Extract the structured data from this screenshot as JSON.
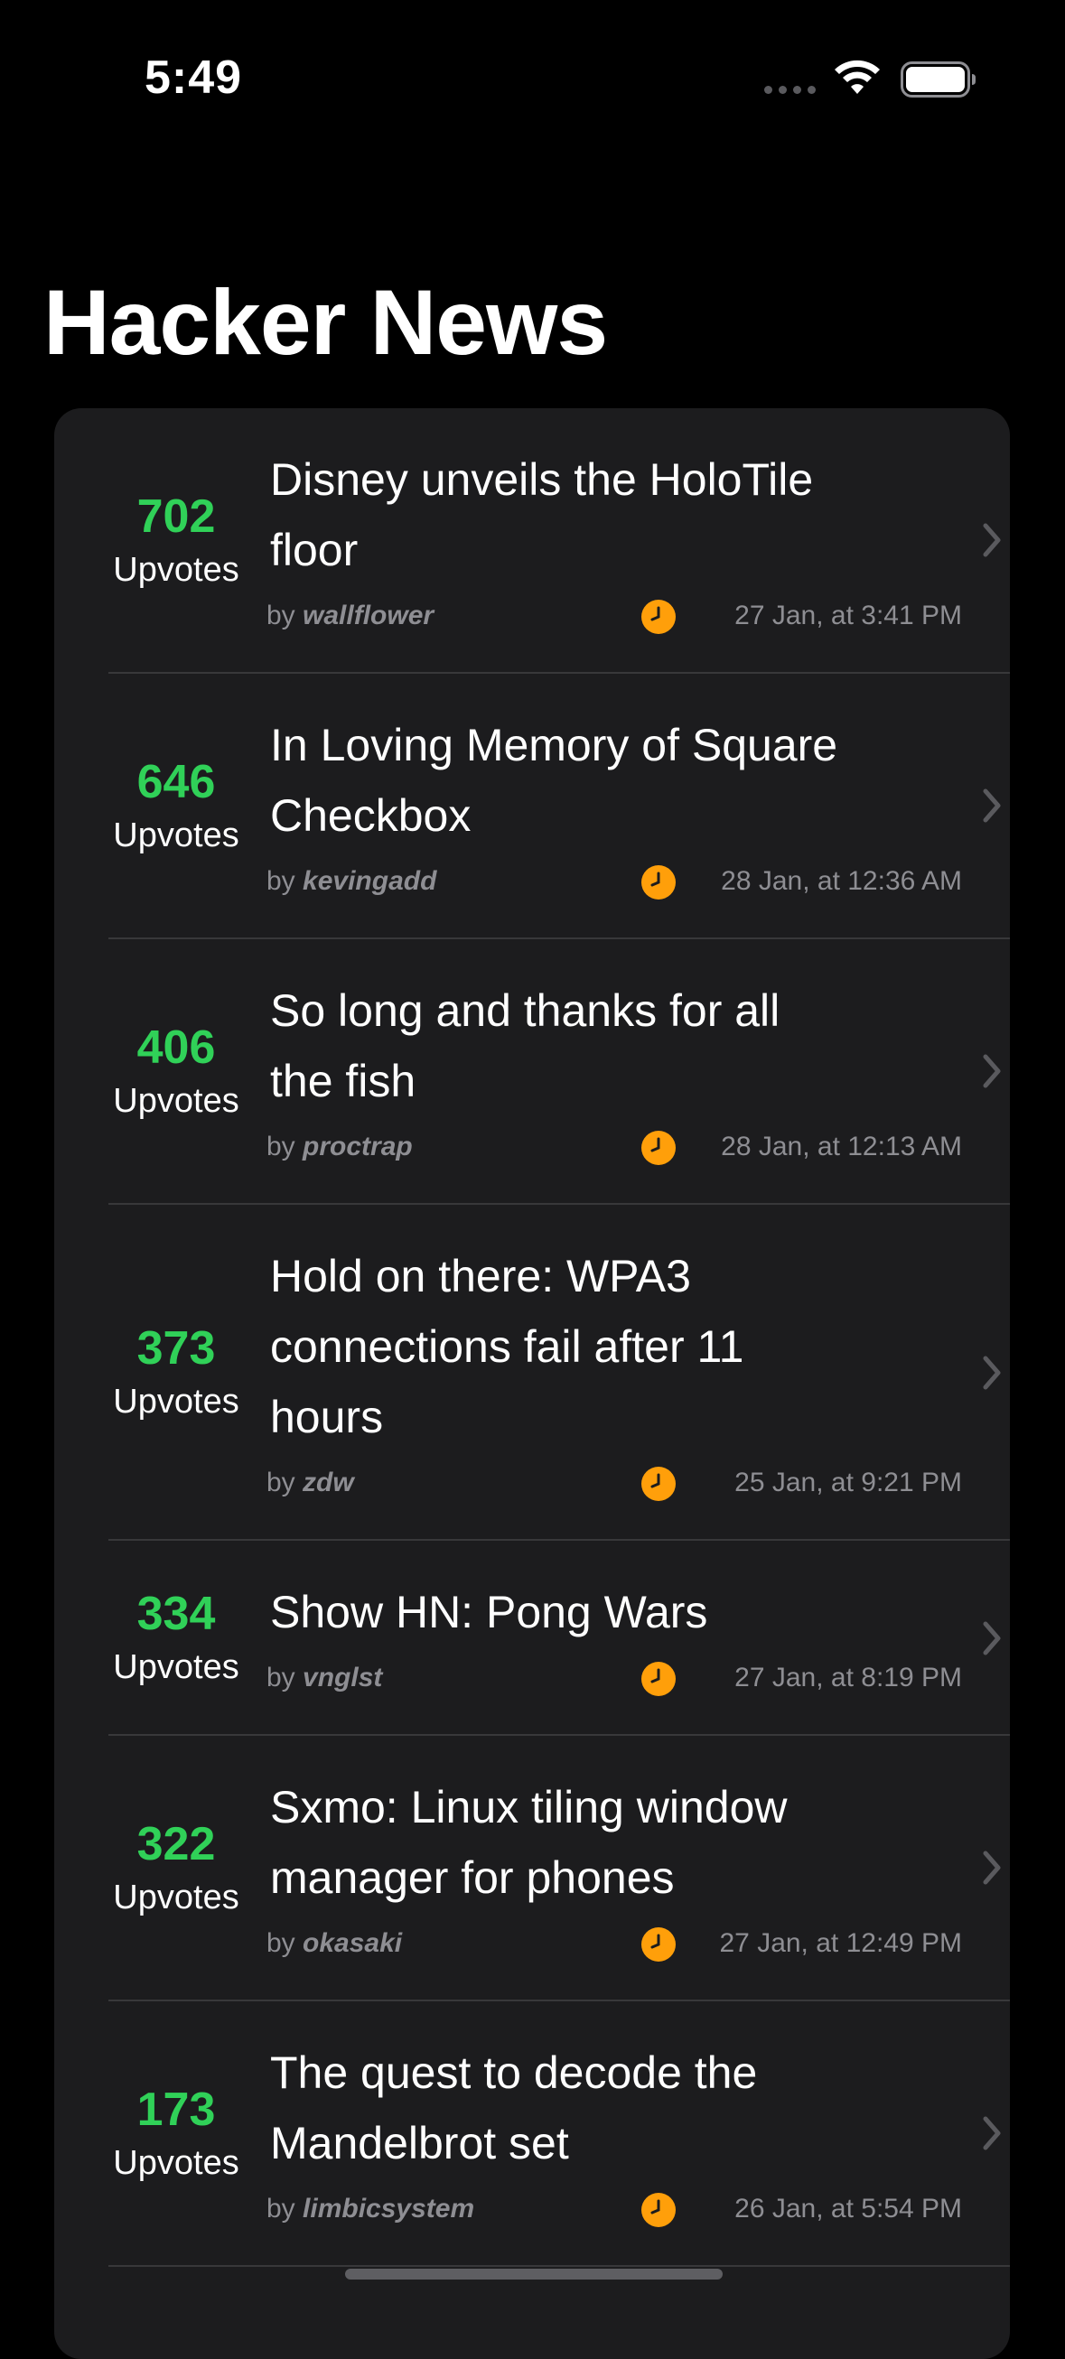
{
  "status_bar": {
    "time": "5:49"
  },
  "header": {
    "title": "Hacker News"
  },
  "colors": {
    "score_green": "#30d158",
    "clock_orange": "#ff9f0a",
    "secondary_text": "#8e8e93",
    "card_background": "#1c1c1e"
  },
  "stories": [
    {
      "score": "702",
      "score_label": "Upvotes",
      "title": "Disney unveils the HoloTile floor",
      "by": "by",
      "author": "wallflower",
      "date": "27 Jan, at 3:41 PM"
    },
    {
      "score": "646",
      "score_label": "Upvotes",
      "title": "In Loving Memory of Square Checkbox",
      "by": "by",
      "author": "kevingadd",
      "date": "28 Jan, at 12:36 AM"
    },
    {
      "score": "406",
      "score_label": "Upvotes",
      "title": "So long and thanks for all the fish",
      "by": "by",
      "author": "proctrap",
      "date": "28 Jan, at 12:13 AM"
    },
    {
      "score": "373",
      "score_label": "Upvotes",
      "title": "Hold on there: WPA3 connections fail after 11 hours",
      "by": "by",
      "author": "zdw",
      "date": "25 Jan, at 9:21 PM"
    },
    {
      "score": "334",
      "score_label": "Upvotes",
      "title": "Show HN: Pong Wars",
      "by": "by",
      "author": "vnglst",
      "date": "27 Jan, at 8:19 PM"
    },
    {
      "score": "322",
      "score_label": "Upvotes",
      "title": "Sxmo: Linux tiling window manager for phones",
      "by": "by",
      "author": "okasaki",
      "date": "27 Jan, at 12:49 PM"
    },
    {
      "score": "173",
      "score_label": "Upvotes",
      "title": "The quest to decode the Mandelbrot set",
      "by": "by",
      "author": "limbicsystem",
      "date": "26 Jan, at 5:54 PM"
    }
  ]
}
